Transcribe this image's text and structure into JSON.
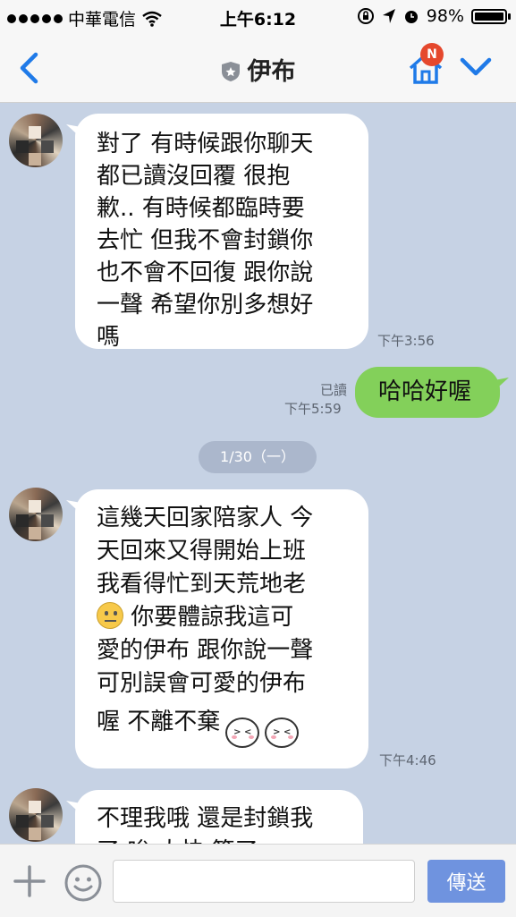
{
  "status_bar": {
    "carrier": "中華電信",
    "time": "上午6:12",
    "battery": "98%"
  },
  "header": {
    "title": "伊布",
    "badge": "N"
  },
  "messages": {
    "m1": {
      "text": "對了 有時候跟你聊天\n都已讀沒回覆 很抱\n歉.. 有時候都臨時要\n去忙 但我不會封鎖你\n也不會不回復 跟你說\n一聲 希望你別多想好\n嗎",
      "time": "下午3:56"
    },
    "m2": {
      "text": "哈哈好喔",
      "read": "已讀",
      "time": "下午5:59"
    },
    "date": "1/30（一）",
    "m3": {
      "line1": "這幾天回家陪家人 今",
      "line2": "天回來又得開始上班",
      "line3": "我看得忙到天荒地老",
      "line4": "你要體諒我這可",
      "line5": "愛的伊布 跟你說一聲",
      "line6": "可別誤會可愛的伊布",
      "line7": "喔  不離不棄",
      "time": "下午4:46"
    },
    "m4": {
      "line1": "不理我哦 還是封鎖我",
      "line2": "了 唉 大快 算了"
    }
  },
  "input_bar": {
    "placeholder": "",
    "send_label": "傳送"
  },
  "colors": {
    "chat_bg": "#c6d2e4",
    "outgoing_bubble": "#83d05a",
    "accent_blue": "#1f7ae8",
    "send_button": "#6f93df"
  },
  "icons": [
    "back-icon",
    "shield-icon",
    "home-icon",
    "chevron-down-icon",
    "plus-icon",
    "emoji-icon"
  ]
}
